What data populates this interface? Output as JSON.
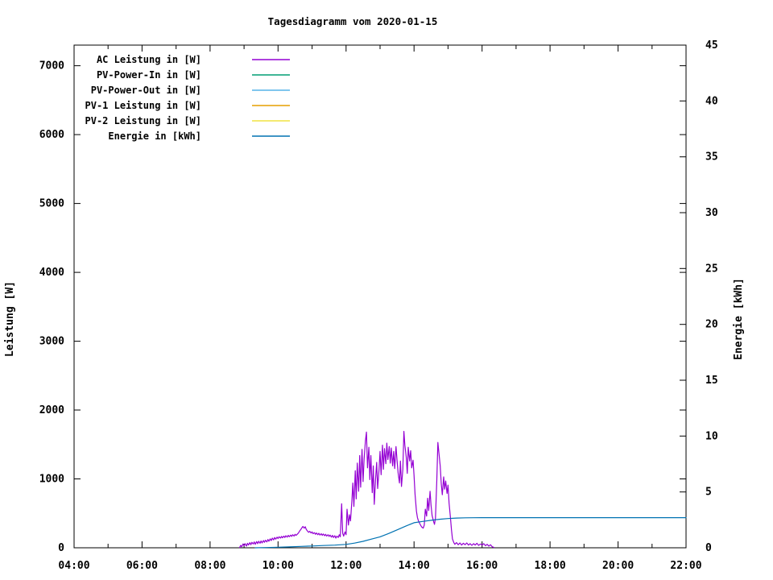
{
  "page": {
    "background_color": "#ffffff",
    "text_color": "#000000"
  },
  "chart_data": {
    "type": "line",
    "title": "Tagesdiagramm vom 2020-01-15",
    "grid": false,
    "legend_position": "top-left-inside",
    "x_axis": {
      "min_hour": 4,
      "max_hour": 22,
      "major_tick_step_hours": 2,
      "minor_tick_step_hours": 1,
      "tick_labels": [
        "04:00",
        "06:00",
        "08:00",
        "10:00",
        "12:00",
        "14:00",
        "16:00",
        "18:00",
        "20:00",
        "22:00"
      ]
    },
    "y_axis_left": {
      "label": "Leistung [W]",
      "min": 0,
      "max": 7300,
      "tick_step": 1000,
      "tick_labels": [
        "0",
        "1000",
        "2000",
        "3000",
        "4000",
        "5000",
        "6000",
        "7000"
      ]
    },
    "y_axis_right": {
      "label": "Energie [kWh]",
      "min": 0,
      "max": 45,
      "tick_step": 5,
      "tick_labels": [
        "0",
        "5",
        "10",
        "15",
        "20",
        "25",
        "30",
        "35",
        "40",
        "45"
      ]
    },
    "series": [
      {
        "name": "AC Leistung in [W]",
        "color": "#9400d3",
        "axis": "left",
        "visible": true,
        "points": [
          [
            8.87,
            5
          ],
          [
            8.9,
            35
          ],
          [
            8.93,
            15
          ],
          [
            8.97,
            55
          ],
          [
            9.0,
            30
          ],
          [
            9.03,
            60
          ],
          [
            9.07,
            25
          ],
          [
            9.1,
            65
          ],
          [
            9.13,
            40
          ],
          [
            9.17,
            75
          ],
          [
            9.2,
            45
          ],
          [
            9.23,
            80
          ],
          [
            9.27,
            55
          ],
          [
            9.3,
            85
          ],
          [
            9.33,
            50
          ],
          [
            9.37,
            90
          ],
          [
            9.4,
            60
          ],
          [
            9.43,
            95
          ],
          [
            9.47,
            65
          ],
          [
            9.5,
            100
          ],
          [
            9.53,
            70
          ],
          [
            9.57,
            105
          ],
          [
            9.6,
            80
          ],
          [
            9.63,
            110
          ],
          [
            9.67,
            85
          ],
          [
            9.7,
            120
          ],
          [
            9.73,
            95
          ],
          [
            9.77,
            130
          ],
          [
            9.8,
            105
          ],
          [
            9.83,
            140
          ],
          [
            9.87,
            115
          ],
          [
            9.9,
            150
          ],
          [
            9.93,
            125
          ],
          [
            9.97,
            155
          ],
          [
            10.0,
            135
          ],
          [
            10.03,
            160
          ],
          [
            10.07,
            140
          ],
          [
            10.1,
            165
          ],
          [
            10.13,
            145
          ],
          [
            10.17,
            170
          ],
          [
            10.2,
            150
          ],
          [
            10.23,
            175
          ],
          [
            10.27,
            155
          ],
          [
            10.3,
            180
          ],
          [
            10.33,
            160
          ],
          [
            10.37,
            185
          ],
          [
            10.4,
            165
          ],
          [
            10.43,
            190
          ],
          [
            10.47,
            170
          ],
          [
            10.5,
            195
          ],
          [
            10.53,
            180
          ],
          [
            10.57,
            200
          ],
          [
            10.6,
            215
          ],
          [
            10.63,
            240
          ],
          [
            10.67,
            265
          ],
          [
            10.7,
            290
          ],
          [
            10.73,
            310
          ],
          [
            10.77,
            285
          ],
          [
            10.8,
            305
          ],
          [
            10.83,
            265
          ],
          [
            10.87,
            240
          ],
          [
            10.9,
            225
          ],
          [
            10.93,
            240
          ],
          [
            10.97,
            215
          ],
          [
            11.0,
            230
          ],
          [
            11.03,
            205
          ],
          [
            11.07,
            220
          ],
          [
            11.1,
            195
          ],
          [
            11.13,
            215
          ],
          [
            11.17,
            190
          ],
          [
            11.2,
            210
          ],
          [
            11.23,
            185
          ],
          [
            11.27,
            205
          ],
          [
            11.3,
            180
          ],
          [
            11.33,
            200
          ],
          [
            11.37,
            175
          ],
          [
            11.4,
            195
          ],
          [
            11.43,
            170
          ],
          [
            11.47,
            190
          ],
          [
            11.5,
            165
          ],
          [
            11.53,
            185
          ],
          [
            11.57,
            155
          ],
          [
            11.6,
            180
          ],
          [
            11.63,
            150
          ],
          [
            11.67,
            175
          ],
          [
            11.7,
            140
          ],
          [
            11.73,
            170
          ],
          [
            11.77,
            150
          ],
          [
            11.8,
            190
          ],
          [
            11.83,
            160
          ],
          [
            11.87,
            640
          ],
          [
            11.9,
            210
          ],
          [
            11.93,
            170
          ],
          [
            11.97,
            230
          ],
          [
            12.0,
            190
          ],
          [
            12.03,
            560
          ],
          [
            12.07,
            330
          ],
          [
            12.1,
            480
          ],
          [
            12.13,
            390
          ],
          [
            12.17,
            680
          ],
          [
            12.2,
            940
          ],
          [
            12.23,
            600
          ],
          [
            12.27,
            1120
          ],
          [
            12.3,
            710
          ],
          [
            12.33,
            1230
          ],
          [
            12.37,
            820
          ],
          [
            12.4,
            1340
          ],
          [
            12.43,
            880
          ],
          [
            12.47,
            1430
          ],
          [
            12.5,
            960
          ],
          [
            12.53,
            1290
          ],
          [
            12.57,
            1550
          ],
          [
            12.6,
            1680
          ],
          [
            12.63,
            1160
          ],
          [
            12.67,
            1460
          ],
          [
            12.7,
            990
          ],
          [
            12.73,
            1340
          ],
          [
            12.77,
            800
          ],
          [
            12.8,
            1190
          ],
          [
            12.83,
            630
          ],
          [
            12.87,
            1010
          ],
          [
            12.9,
            1240
          ],
          [
            12.93,
            860
          ],
          [
            12.97,
            1130
          ],
          [
            13.0,
            1400
          ],
          [
            13.03,
            1060
          ],
          [
            13.07,
            1490
          ],
          [
            13.1,
            1140
          ],
          [
            13.13,
            1440
          ],
          [
            13.17,
            1220
          ],
          [
            13.2,
            1520
          ],
          [
            13.23,
            1280
          ],
          [
            13.27,
            1470
          ],
          [
            13.3,
            1230
          ],
          [
            13.33,
            1450
          ],
          [
            13.37,
            1190
          ],
          [
            13.4,
            1400
          ],
          [
            13.43,
            1150
          ],
          [
            13.47,
            1470
          ],
          [
            13.5,
            1270
          ],
          [
            13.53,
            1090
          ],
          [
            13.57,
            940
          ],
          [
            13.6,
            1260
          ],
          [
            13.63,
            890
          ],
          [
            13.67,
            1140
          ],
          [
            13.7,
            1690
          ],
          [
            13.73,
            1490
          ],
          [
            13.77,
            1320
          ],
          [
            13.8,
            1080
          ],
          [
            13.83,
            1460
          ],
          [
            13.87,
            1260
          ],
          [
            13.9,
            1410
          ],
          [
            13.93,
            1160
          ],
          [
            13.97,
            1270
          ],
          [
            14.0,
            1050
          ],
          [
            14.03,
            770
          ],
          [
            14.07,
            530
          ],
          [
            14.1,
            440
          ],
          [
            14.13,
            390
          ],
          [
            14.17,
            350
          ],
          [
            14.2,
            320
          ],
          [
            14.23,
            300
          ],
          [
            14.27,
            285
          ],
          [
            14.3,
            330
          ],
          [
            14.33,
            560
          ],
          [
            14.37,
            460
          ],
          [
            14.4,
            720
          ],
          [
            14.43,
            540
          ],
          [
            14.47,
            820
          ],
          [
            14.5,
            620
          ],
          [
            14.53,
            470
          ],
          [
            14.57,
            390
          ],
          [
            14.6,
            340
          ],
          [
            14.63,
            430
          ],
          [
            14.67,
            990
          ],
          [
            14.7,
            1530
          ],
          [
            14.73,
            1390
          ],
          [
            14.77,
            1190
          ],
          [
            14.8,
            930
          ],
          [
            14.83,
            770
          ],
          [
            14.87,
            1030
          ],
          [
            14.9,
            850
          ],
          [
            14.93,
            970
          ],
          [
            14.97,
            790
          ],
          [
            15.0,
            910
          ],
          [
            15.03,
            650
          ],
          [
            15.07,
            440
          ],
          [
            15.1,
            260
          ],
          [
            15.13,
            130
          ],
          [
            15.17,
            75
          ],
          [
            15.2,
            50
          ],
          [
            15.25,
            75
          ],
          [
            15.3,
            45
          ],
          [
            15.35,
            70
          ],
          [
            15.4,
            40
          ],
          [
            15.45,
            65
          ],
          [
            15.5,
            45
          ],
          [
            15.55,
            70
          ],
          [
            15.6,
            40
          ],
          [
            15.65,
            60
          ],
          [
            15.7,
            35
          ],
          [
            15.75,
            60
          ],
          [
            15.8,
            40
          ],
          [
            15.85,
            65
          ],
          [
            15.9,
            35
          ],
          [
            15.95,
            55
          ],
          [
            16.0,
            40
          ],
          [
            16.05,
            60
          ],
          [
            16.1,
            30
          ],
          [
            16.15,
            50
          ],
          [
            16.2,
            25
          ],
          [
            16.25,
            45
          ],
          [
            16.3,
            15
          ],
          [
            16.35,
            5
          ]
        ]
      },
      {
        "name": "PV-Power-In in [W]",
        "color": "#009e73",
        "axis": "left",
        "visible": false,
        "points": []
      },
      {
        "name": "PV-Power-Out in [W]",
        "color": "#56b4e9",
        "axis": "left",
        "visible": false,
        "points": []
      },
      {
        "name": "PV-1 Leistung in [W]",
        "color": "#e69f00",
        "axis": "left",
        "visible": false,
        "points": []
      },
      {
        "name": "PV-2 Leistung in [W]",
        "color": "#f0e442",
        "axis": "left",
        "visible": false,
        "points": []
      },
      {
        "name": "Energie in [kWh]",
        "color": "#0072b2",
        "axis": "right",
        "visible": true,
        "points": [
          [
            9.33,
            0
          ],
          [
            9.67,
            0.02
          ],
          [
            10.0,
            0.05
          ],
          [
            10.33,
            0.08
          ],
          [
            10.67,
            0.12
          ],
          [
            11.0,
            0.16
          ],
          [
            11.33,
            0.2
          ],
          [
            11.67,
            0.24
          ],
          [
            12.0,
            0.3
          ],
          [
            12.25,
            0.42
          ],
          [
            12.5,
            0.58
          ],
          [
            12.75,
            0.78
          ],
          [
            13.0,
            0.98
          ],
          [
            13.25,
            1.28
          ],
          [
            13.5,
            1.6
          ],
          [
            13.75,
            1.93
          ],
          [
            14.0,
            2.24
          ],
          [
            14.25,
            2.36
          ],
          [
            14.5,
            2.46
          ],
          [
            14.75,
            2.55
          ],
          [
            15.0,
            2.62
          ],
          [
            15.25,
            2.66
          ],
          [
            15.5,
            2.68
          ],
          [
            15.75,
            2.69
          ],
          [
            16.0,
            2.7
          ],
          [
            17.0,
            2.7
          ],
          [
            18.0,
            2.7
          ],
          [
            20.0,
            2.7
          ],
          [
            22.0,
            2.7
          ]
        ]
      }
    ],
    "note": "Legend-only series (PV-Power-In/Out, PV-1, PV-2) lie flat at 0 W along the x-axis and are not visually distinguishable."
  }
}
